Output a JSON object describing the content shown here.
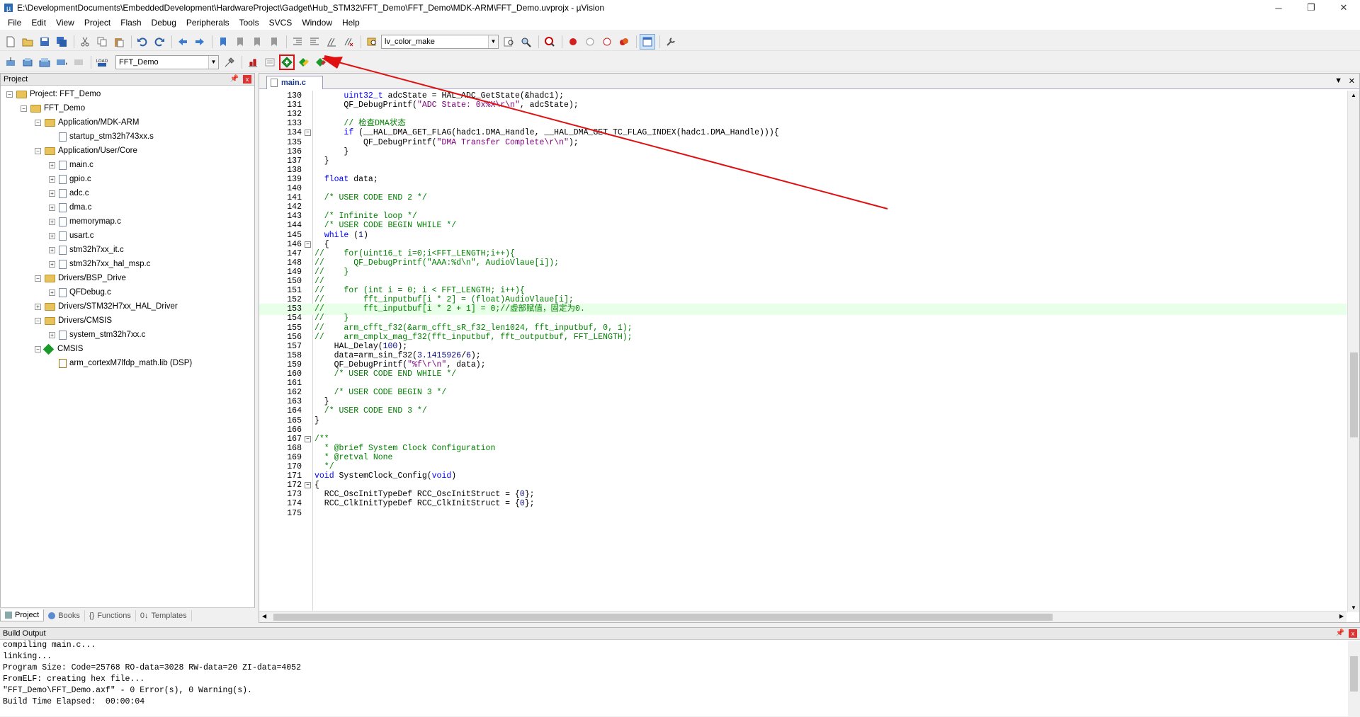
{
  "window": {
    "title": "E:\\DevelopmentDocuments\\EmbeddedDevelopment\\HardwareProject\\Gadget\\Hub_STM32\\FFT_Demo\\FFT_Demo\\MDK-ARM\\FFT_Demo.uvprojx - µVision",
    "min": "─",
    "max": "❐",
    "close": "✕"
  },
  "menu": [
    "File",
    "Edit",
    "View",
    "Project",
    "Flash",
    "Debug",
    "Peripherals",
    "Tools",
    "SVCS",
    "Window",
    "Help"
  ],
  "toolbar1": {
    "find_combo": "lv_color_make"
  },
  "toolbar2": {
    "target_combo": "FFT_Demo"
  },
  "project_panel": {
    "title": "Project",
    "pin": "📌",
    "close": "x",
    "tree": [
      {
        "label": "Project: FFT_Demo",
        "level": 0,
        "kind": "project",
        "exp": "−"
      },
      {
        "label": "FFT_Demo",
        "level": 1,
        "kind": "folder",
        "exp": "−"
      },
      {
        "label": "Application/MDK-ARM",
        "level": 2,
        "kind": "folder",
        "exp": "−"
      },
      {
        "label": "startup_stm32h743xx.s",
        "level": 3,
        "kind": "file",
        "exp": ""
      },
      {
        "label": "Application/User/Core",
        "level": 2,
        "kind": "folder",
        "exp": "−"
      },
      {
        "label": "main.c",
        "level": 3,
        "kind": "file",
        "exp": "+"
      },
      {
        "label": "gpio.c",
        "level": 3,
        "kind": "file",
        "exp": "+"
      },
      {
        "label": "adc.c",
        "level": 3,
        "kind": "file",
        "exp": "+"
      },
      {
        "label": "dma.c",
        "level": 3,
        "kind": "file",
        "exp": "+"
      },
      {
        "label": "memorymap.c",
        "level": 3,
        "kind": "file",
        "exp": "+"
      },
      {
        "label": "usart.c",
        "level": 3,
        "kind": "file",
        "exp": "+"
      },
      {
        "label": "stm32h7xx_it.c",
        "level": 3,
        "kind": "file",
        "exp": "+"
      },
      {
        "label": "stm32h7xx_hal_msp.c",
        "level": 3,
        "kind": "file",
        "exp": "+"
      },
      {
        "label": "Drivers/BSP_Drive",
        "level": 2,
        "kind": "folder",
        "exp": "−"
      },
      {
        "label": "QFDebug.c",
        "level": 3,
        "kind": "file",
        "exp": "+"
      },
      {
        "label": "Drivers/STM32H7xx_HAL_Driver",
        "level": 2,
        "kind": "folder",
        "exp": "+"
      },
      {
        "label": "Drivers/CMSIS",
        "level": 2,
        "kind": "folder",
        "exp": "−"
      },
      {
        "label": "system_stm32h7xx.c",
        "level": 3,
        "kind": "file",
        "exp": "+"
      },
      {
        "label": "CMSIS",
        "level": 2,
        "kind": "diamond",
        "exp": "−"
      },
      {
        "label": "arm_cortexM7lfdp_math.lib (DSP)",
        "level": 3,
        "kind": "lib",
        "exp": ""
      }
    ],
    "tabs": [
      "Project",
      "Books",
      "Functions",
      "Templates"
    ]
  },
  "editor": {
    "tab": "main.c",
    "lines": [
      {
        "n": "130",
        "f": "",
        "t": "      uint32_t adcState = HAL_ADC_GetState(&hadc1);"
      },
      {
        "n": "131",
        "f": "",
        "t": "      QF_DebugPrintf(\"ADC State: 0x%X\\r\\n\", adcState);"
      },
      {
        "n": "132",
        "f": "",
        "t": ""
      },
      {
        "n": "133",
        "f": "",
        "t": "      // 检查DMA状态"
      },
      {
        "n": "134",
        "f": "−",
        "t": "      if (__HAL_DMA_GET_FLAG(hadc1.DMA_Handle, __HAL_DMA_GET_TC_FLAG_INDEX(hadc1.DMA_Handle))){"
      },
      {
        "n": "135",
        "f": "",
        "t": "          QF_DebugPrintf(\"DMA Transfer Complete\\r\\n\");"
      },
      {
        "n": "136",
        "f": "",
        "t": "      }"
      },
      {
        "n": "137",
        "f": "",
        "t": "  }"
      },
      {
        "n": "138",
        "f": "",
        "t": ""
      },
      {
        "n": "139",
        "f": "",
        "t": "  float data;"
      },
      {
        "n": "140",
        "f": "",
        "t": ""
      },
      {
        "n": "141",
        "f": "",
        "t": "  /* USER CODE END 2 */"
      },
      {
        "n": "142",
        "f": "",
        "t": ""
      },
      {
        "n": "143",
        "f": "",
        "t": "  /* Infinite loop */"
      },
      {
        "n": "144",
        "f": "",
        "t": "  /* USER CODE BEGIN WHILE */"
      },
      {
        "n": "145",
        "f": "",
        "t": "  while (1)"
      },
      {
        "n": "146",
        "f": "−",
        "t": "  {"
      },
      {
        "n": "147",
        "f": "",
        "t": "//    for(uint16_t i=0;i<FFT_LENGTH;i++){"
      },
      {
        "n": "148",
        "f": "",
        "t": "//      QF_DebugPrintf(\"AAA:%d\\n\", AudioVlaue[i]);"
      },
      {
        "n": "149",
        "f": "",
        "t": "//    }"
      },
      {
        "n": "150",
        "f": "",
        "t": "//"
      },
      {
        "n": "151",
        "f": "",
        "t": "//    for (int i = 0; i < FFT_LENGTH; i++){"
      },
      {
        "n": "152",
        "f": "",
        "t": "//        fft_inputbuf[i * 2] = (float)AudioVlaue[i];"
      },
      {
        "n": "153",
        "f": "",
        "t": "//        fft_inputbuf[i * 2 + 1] = 0;//虚部赋值，固定为0."
      },
      {
        "n": "154",
        "f": "",
        "t": "//    }"
      },
      {
        "n": "155",
        "f": "",
        "t": "//    arm_cfft_f32(&arm_cfft_sR_f32_len1024, fft_inputbuf, 0, 1);"
      },
      {
        "n": "156",
        "f": "",
        "t": "//    arm_cmplx_mag_f32(fft_inputbuf, fft_outputbuf, FFT_LENGTH);"
      },
      {
        "n": "157",
        "f": "",
        "t": "    HAL_Delay(100);"
      },
      {
        "n": "158",
        "f": "",
        "t": "    data=arm_sin_f32(3.1415926/6);"
      },
      {
        "n": "159",
        "f": "",
        "t": "    QF_DebugPrintf(\"%f\\r\\n\", data);"
      },
      {
        "n": "160",
        "f": "",
        "t": "    /* USER CODE END WHILE */"
      },
      {
        "n": "161",
        "f": "",
        "t": ""
      },
      {
        "n": "162",
        "f": "",
        "t": "    /* USER CODE BEGIN 3 */"
      },
      {
        "n": "163",
        "f": "",
        "t": "  }"
      },
      {
        "n": "164",
        "f": "",
        "t": "  /* USER CODE END 3 */"
      },
      {
        "n": "165",
        "f": "",
        "t": "}"
      },
      {
        "n": "166",
        "f": "",
        "t": ""
      },
      {
        "n": "167",
        "f": "−",
        "t": "/**"
      },
      {
        "n": "168",
        "f": "",
        "t": "  * @brief System Clock Configuration"
      },
      {
        "n": "169",
        "f": "",
        "t": "  * @retval None"
      },
      {
        "n": "170",
        "f": "",
        "t": "  */"
      },
      {
        "n": "171",
        "f": "",
        "t": "void SystemClock_Config(void)"
      },
      {
        "n": "172",
        "f": "−",
        "t": "{"
      },
      {
        "n": "173",
        "f": "",
        "t": "  RCC_OscInitTypeDef RCC_OscInitStruct = {0};"
      },
      {
        "n": "174",
        "f": "",
        "t": "  RCC_ClkInitTypeDef RCC_ClkInitStruct = {0};"
      },
      {
        "n": "175",
        "f": "",
        "t": ""
      }
    ],
    "highlighted_line": "153",
    "current_line": "139"
  },
  "build_output": {
    "title": "Build Output",
    "lines": [
      "compiling main.c...",
      "linking...",
      "Program Size: Code=25768 RO-data=3028 RW-data=20 ZI-data=4052",
      "FromELF: creating hex file...",
      "\"FFT_Demo\\FFT_Demo.axf\" - 0 Error(s), 0 Warning(s).",
      "Build Time Elapsed:  00:00:04"
    ]
  },
  "colors": {
    "keyword": "#0000ff",
    "comment": "#008000",
    "string": "#800080",
    "annotation": "#e01010",
    "highlight_line": "#e8ffe8"
  },
  "icons": [
    "app-icon",
    "new-file-icon",
    "open-icon",
    "save-icon",
    "save-all-icon",
    "cut-icon",
    "copy-icon",
    "paste-icon",
    "undo-icon",
    "redo-icon",
    "back-icon",
    "forward-icon",
    "bookmark-icon",
    "indent-icon",
    "outdent-icon",
    "comment-icon",
    "uncomment-icon",
    "find-in-files-icon",
    "search-icon",
    "debug-icon",
    "breakpoint-icon",
    "configure-icon",
    "translate-icon",
    "build-icon",
    "rebuild-icon",
    "batch-build-icon",
    "stop-build-icon",
    "download-icon",
    "target-options-icon",
    "manage-components-icon",
    "pack-installer-icon"
  ]
}
